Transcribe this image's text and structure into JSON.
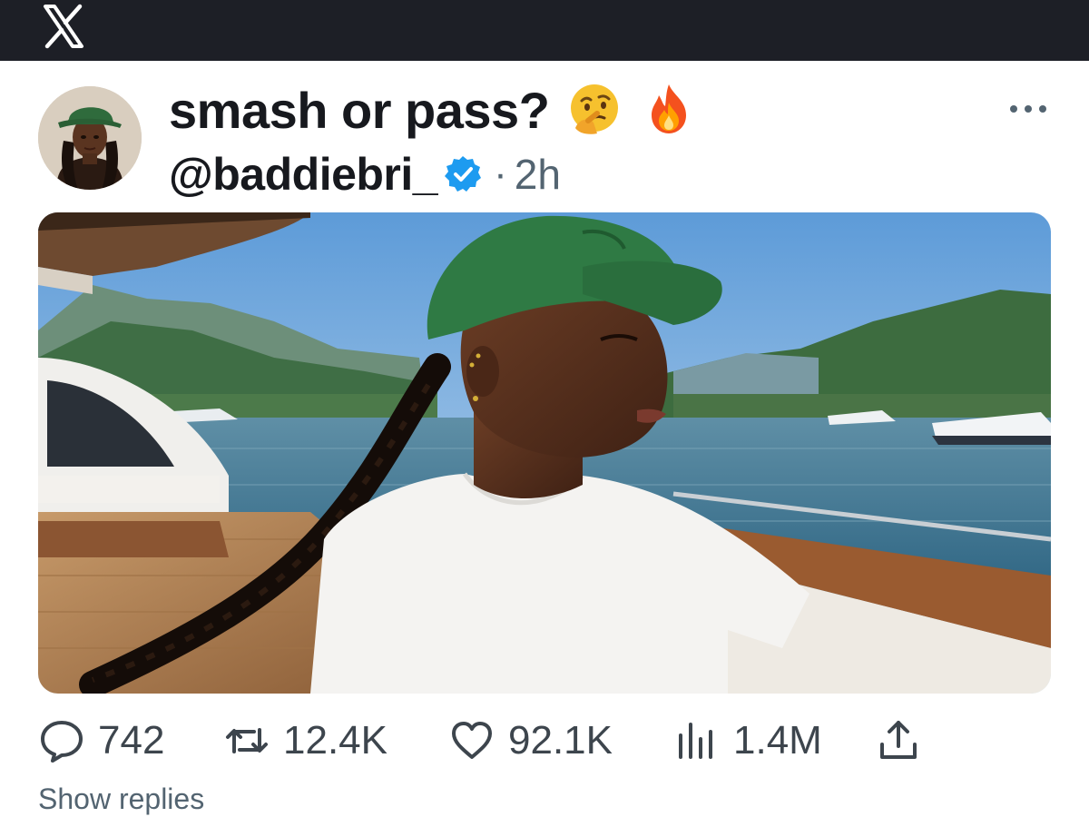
{
  "app": {
    "logo": "x-logo-icon",
    "bar_color": "#1d1f26"
  },
  "post": {
    "text": "smash or pass?",
    "emojis": [
      "thinking-face-icon",
      "fire-icon"
    ],
    "handle": "@baddiebri_",
    "verified": true,
    "separator": "·",
    "time": "2h",
    "more_icon": "more-horizontal-icon",
    "verified_color": "#1d9bf0"
  },
  "actions": {
    "replies": {
      "icon": "comment-icon",
      "count": "742"
    },
    "reposts": {
      "icon": "repost-icon",
      "count": "12.4K"
    },
    "likes": {
      "icon": "heart-icon",
      "count": "92.1K"
    },
    "views": {
      "icon": "views-bar-chart-icon",
      "count": "1.4M"
    },
    "share": {
      "icon": "share-upload-icon"
    }
  },
  "footer": {
    "show_replies": "Show replies"
  }
}
